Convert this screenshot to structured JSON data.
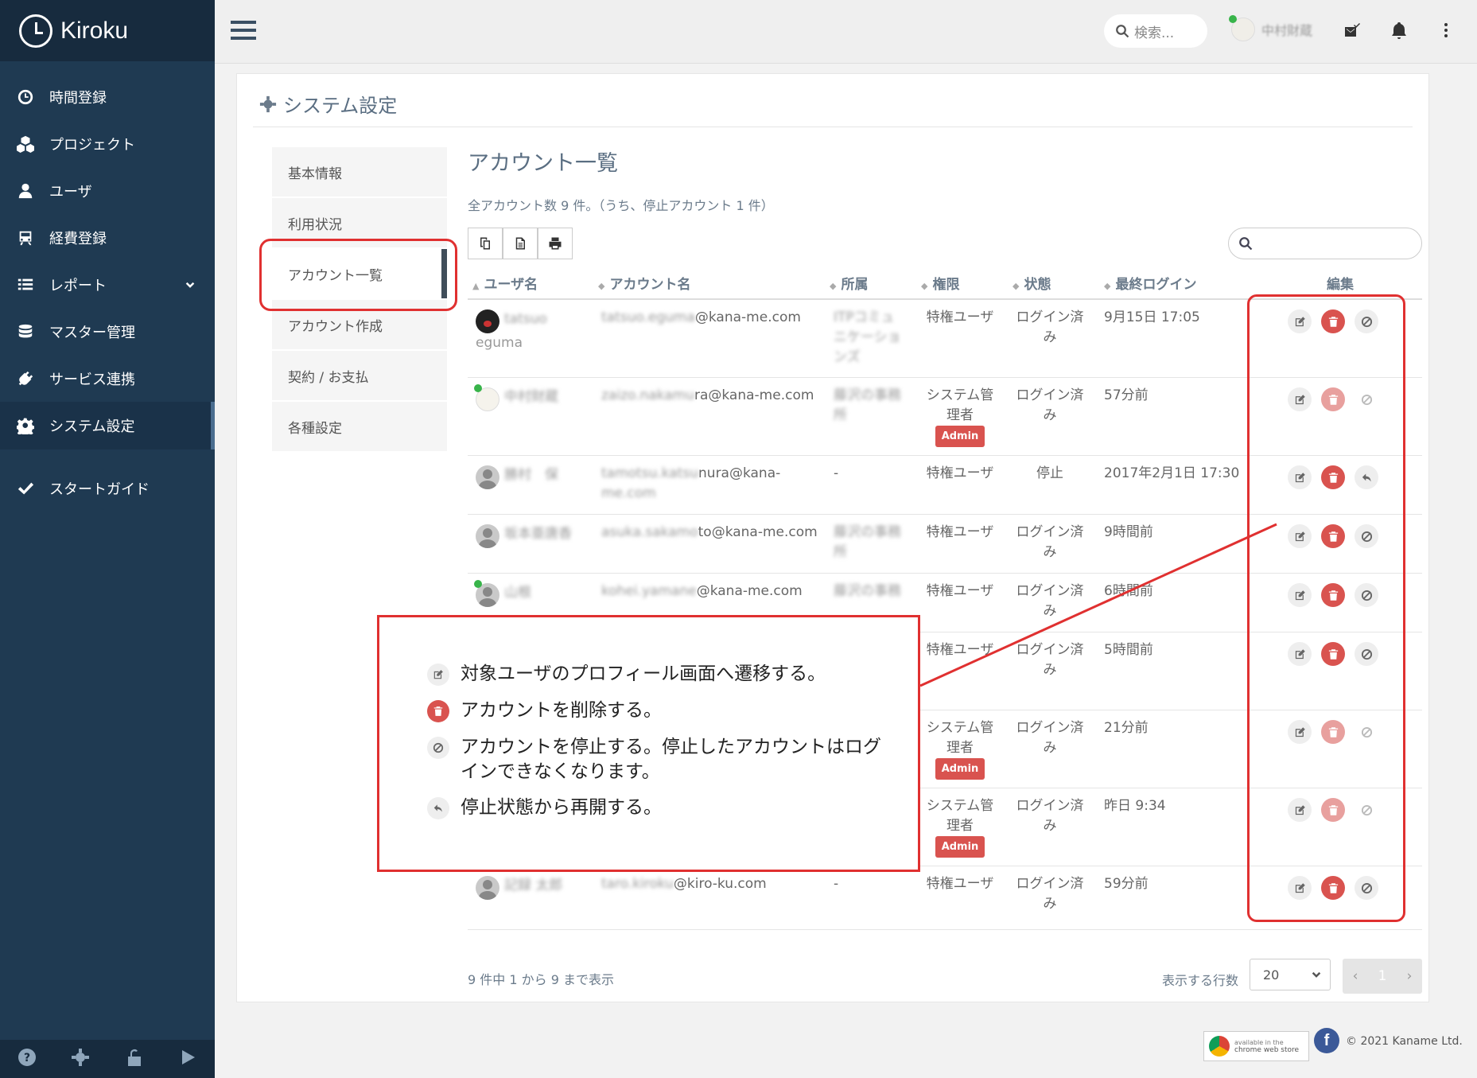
{
  "app": {
    "name": "Kiroku"
  },
  "sidebar": {
    "items": [
      {
        "label": "時間登録",
        "icon": "clock-icon"
      },
      {
        "label": "プロジェクト",
        "icon": "cubes-icon"
      },
      {
        "label": "ユーザ",
        "icon": "user-icon"
      },
      {
        "label": "経費登録",
        "icon": "train-icon"
      },
      {
        "label": "レポート",
        "icon": "list-icon"
      },
      {
        "label": "マスター管理",
        "icon": "database-icon"
      },
      {
        "label": "サービス連携",
        "icon": "plug-icon"
      },
      {
        "label": "システム設定",
        "icon": "gear-icon"
      },
      {
        "label": "スタートガイド",
        "icon": "check-icon"
      }
    ],
    "active": "システム設定"
  },
  "header": {
    "search_placeholder": "検索...",
    "user_name": "中村財蔵"
  },
  "page": {
    "title": "システム設定",
    "subnav": [
      "基本情報",
      "利用状況",
      "アカウント一覧",
      "アカウント作成",
      "契約 / お支払",
      "各種設定"
    ],
    "subnav_active": "アカウント一覧",
    "heading": "アカウント一覧",
    "summary": "全アカウント数 9 件。（うち、停止アカウント 1 件）"
  },
  "table": {
    "columns": [
      "ユーザ名",
      "アカウント名",
      "所属",
      "権限",
      "状態",
      "最終ログイン",
      "編集"
    ],
    "rows": [
      {
        "name1": "tatsuo",
        "name2": "eguma",
        "account1": "tatsuo.eguma",
        "account2": "@kana-me.com",
        "dept1": "ITPコミュ",
        "dept2": "ニケーショ",
        "dept3": "ンズ",
        "role1": "特権ユーザ",
        "role2": "",
        "admin": "",
        "status1": "ログイン済",
        "status2": "み",
        "last": "9月15日 17:05"
      },
      {
        "name1": "中村財蔵",
        "name2": "",
        "account1": "zaizo.nakamu",
        "account2": "ra@kana-me.com",
        "dept1": "藤沢の事務",
        "dept2": "所",
        "dept3": "",
        "role1": "システム管",
        "role2": "理者",
        "admin": "Admin",
        "status1": "ログイン済",
        "status2": "み",
        "last": "57分前"
      },
      {
        "name1": "勝村　保",
        "name2": "",
        "account1": "tamotsu.katsu",
        "account2": "nura@kana-",
        "account3": "me.com",
        "dept1": "-",
        "dept2": "",
        "dept3": "",
        "role1": "特権ユーザ",
        "role2": "",
        "admin": "",
        "status1": "停止",
        "status2": "",
        "last": "2017年2月1日 17:30"
      },
      {
        "name1": "坂本亜唐香",
        "name2": "",
        "account1": "asuka.sakamo",
        "account2": "to@kana-me.com",
        "dept1": "藤沢の事務",
        "dept2": "所",
        "dept3": "",
        "role1": "特権ユーザ",
        "role2": "",
        "admin": "",
        "status1": "ログイン済",
        "status2": "み",
        "last": "9時間前"
      },
      {
        "name1": "山根",
        "name2": "",
        "account1": "kohei.yamane",
        "account2": "@kana-me.com",
        "dept1": "藤沢の事務",
        "dept2": "",
        "dept3": "",
        "role1": "特権ユーザ",
        "role2": "",
        "admin": "",
        "status1": "ログイン済",
        "status2": "み",
        "last": "6時間前"
      },
      {
        "name1": "",
        "name2": "",
        "account1": "",
        "account2": "",
        "dept1": "",
        "dept2": "",
        "dept3": "",
        "role1": "特権ユーザ",
        "role2": "",
        "admin": "",
        "status1": "ログイン済",
        "status2": "み",
        "last": "5時間前"
      },
      {
        "name1": "",
        "name2": "",
        "account1": "",
        "account2": "",
        "dept1": "",
        "dept2": "",
        "dept3": "",
        "role1": "システム管",
        "role2": "理者",
        "admin": "Admin",
        "status1": "ログイン済",
        "status2": "み",
        "last": "21分前"
      },
      {
        "name1": "",
        "name2": "",
        "account1": "",
        "account2": "",
        "dept1": "",
        "dept2": "",
        "dept3": "",
        "role1": "システム管",
        "role2": "理者",
        "admin": "Admin",
        "status1": "ログイン済",
        "status2": "み",
        "last": "昨日 9:34"
      },
      {
        "name1": "記録 太郎",
        "name2": "",
        "account1": "taro.kiroku",
        "account2": "@kiro-ku.com",
        "dept1": "-",
        "dept2": "",
        "dept3": "",
        "role1": "特権ユーザ",
        "role2": "",
        "admin": "",
        "status1": "ログイン済",
        "status2": "み",
        "last": "59分前"
      }
    ],
    "footer_info": "9 件中 1 から 9 まで表示",
    "rows_label": "表示する行数",
    "rows_value": "20",
    "page_current": "1"
  },
  "callout": {
    "lines": [
      "対象ユーザのプロフィール画面へ遷移する。",
      "アカウントを削除する。",
      "アカウントを停止する。停止したアカウントはログ",
      "インできなくなります。",
      "停止状態から再開する。"
    ]
  },
  "footer": {
    "cws_line1": "available in the",
    "cws_line2": "chrome web store",
    "copyright": "© 2021 Kaname Ltd."
  },
  "colors": {
    "sidebar": "#1f3a52",
    "annotation": "#e03030",
    "danger": "#d9534f"
  }
}
